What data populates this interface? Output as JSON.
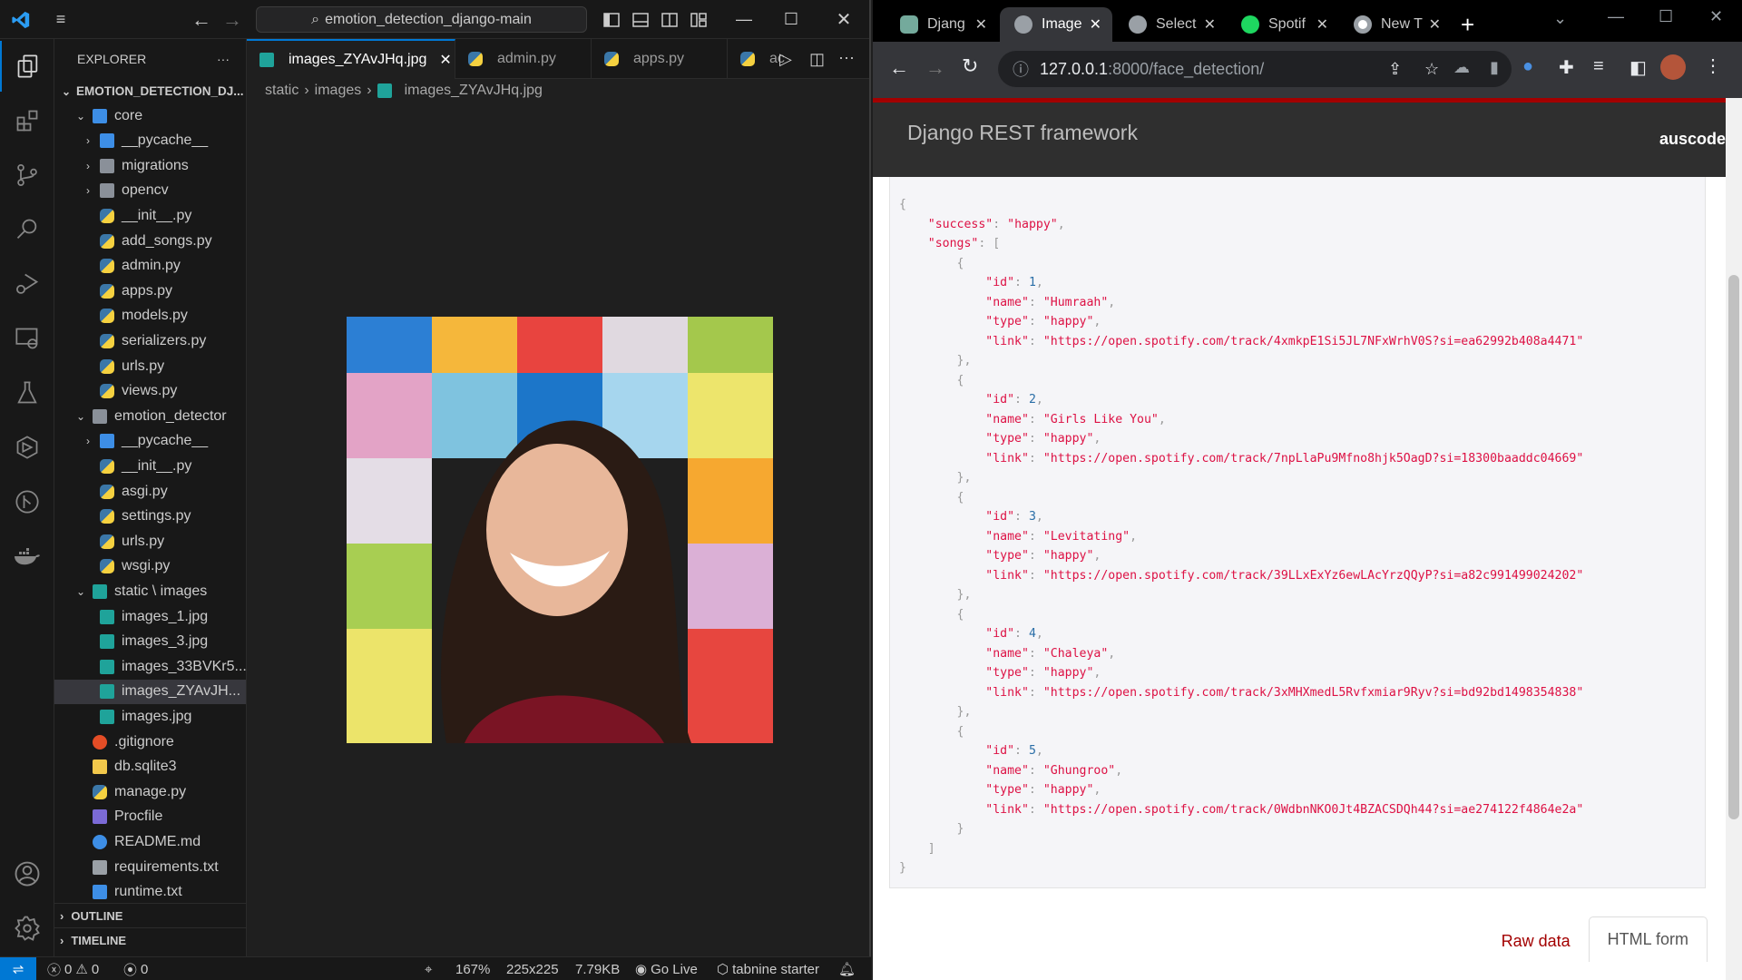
{
  "vscode": {
    "search": "emotion_detection_django-main",
    "explorer_title": "EXPLORER",
    "root_folder": "EMOTION_DETECTION_DJ...",
    "tree": [
      {
        "label": "core",
        "depth": 1,
        "type": "folder-open-blue",
        "chev": "down"
      },
      {
        "label": "__pycache__",
        "depth": 2,
        "type": "folder-py",
        "chev": "right"
      },
      {
        "label": "migrations",
        "depth": 2,
        "type": "folder",
        "chev": "right"
      },
      {
        "label": "opencv",
        "depth": 2,
        "type": "folder",
        "chev": "right"
      },
      {
        "label": "__init__.py",
        "depth": 2,
        "type": "py"
      },
      {
        "label": "add_songs.py",
        "depth": 2,
        "type": "py"
      },
      {
        "label": "admin.py",
        "depth": 2,
        "type": "py"
      },
      {
        "label": "apps.py",
        "depth": 2,
        "type": "py"
      },
      {
        "label": "models.py",
        "depth": 2,
        "type": "py"
      },
      {
        "label": "serializers.py",
        "depth": 2,
        "type": "py"
      },
      {
        "label": "urls.py",
        "depth": 2,
        "type": "py"
      },
      {
        "label": "views.py",
        "depth": 2,
        "type": "py"
      },
      {
        "label": "emotion_detector",
        "depth": 1,
        "type": "folder-open",
        "chev": "down"
      },
      {
        "label": "__pycache__",
        "depth": 2,
        "type": "folder-py",
        "chev": "right"
      },
      {
        "label": "__init__.py",
        "depth": 2,
        "type": "py"
      },
      {
        "label": "asgi.py",
        "depth": 2,
        "type": "py"
      },
      {
        "label": "settings.py",
        "depth": 2,
        "type": "py"
      },
      {
        "label": "urls.py",
        "depth": 2,
        "type": "py"
      },
      {
        "label": "wsgi.py",
        "depth": 2,
        "type": "py"
      },
      {
        "label": "static \\ images",
        "depth": 1,
        "type": "folder-img",
        "chev": "down"
      },
      {
        "label": "images_1.jpg",
        "depth": 2,
        "type": "img"
      },
      {
        "label": "images_3.jpg",
        "depth": 2,
        "type": "img"
      },
      {
        "label": "images_33BVKr5...",
        "depth": 2,
        "type": "img"
      },
      {
        "label": "images_ZYAvJH...",
        "depth": 2,
        "type": "img",
        "selected": true
      },
      {
        "label": "images.jpg",
        "depth": 2,
        "type": "img"
      },
      {
        "label": ".gitignore",
        "depth": 1,
        "type": "git"
      },
      {
        "label": "db.sqlite3",
        "depth": 1,
        "type": "db"
      },
      {
        "label": "manage.py",
        "depth": 1,
        "type": "py"
      },
      {
        "label": "Procfile",
        "depth": 1,
        "type": "heroku"
      },
      {
        "label": "README.md",
        "depth": 1,
        "type": "info"
      },
      {
        "label": "requirements.txt",
        "depth": 1,
        "type": "txt"
      },
      {
        "label": "runtime.txt",
        "depth": 1,
        "type": "txt-blue"
      }
    ],
    "outline": "OUTLINE",
    "timeline": "TIMELINE",
    "tabs": [
      {
        "label": "images_ZYAvJHq.jpg",
        "type": "img",
        "active": true
      },
      {
        "label": "admin.py",
        "type": "py"
      },
      {
        "label": "apps.py",
        "type": "py"
      },
      {
        "label": "ac",
        "type": "py"
      }
    ],
    "breadcrumb": [
      "static",
      "images",
      "images_ZYAvJHq.jpg"
    ],
    "status": {
      "errors": "0",
      "warnings": "0",
      "ports": "0",
      "zoom": "167%",
      "dimensions": "225x225",
      "size": "7.79KB",
      "go_live": "Go Live",
      "tabnine": "tabnine starter"
    }
  },
  "chrome": {
    "tabs": [
      {
        "label": "Djang",
        "icon": "chatgpt",
        "active": false
      },
      {
        "label": "Image",
        "icon": "globe",
        "active": true
      },
      {
        "label": "Select",
        "icon": "globe",
        "active": false
      },
      {
        "label": "Spotif",
        "icon": "spotify",
        "active": false
      },
      {
        "label": "New T",
        "icon": "chrome",
        "active": false
      }
    ],
    "url_host": "127.0.0.1",
    "url_rest": ":8000/face_detection/",
    "brand": "Django REST framework",
    "user": "auscode",
    "raw_data": "Raw data",
    "html_form": "HTML form"
  },
  "response": {
    "success": "happy",
    "songs": [
      {
        "id": 1,
        "name": "Humraah",
        "type": "happy",
        "link": "https://open.spotify.com/track/4xmkpE1Si5JL7NFxWrhV0S?si=ea62992b408a4471"
      },
      {
        "id": 2,
        "name": "Girls Like You",
        "type": "happy",
        "link": "https://open.spotify.com/track/7npLlaPu9Mfno8hjk5OagD?si=18300baaddc04669"
      },
      {
        "id": 3,
        "name": "Levitating",
        "type": "happy",
        "link": "https://open.spotify.com/track/39LLxExYz6ewLAcYrzQQyP?si=a82c991499024202"
      },
      {
        "id": 4,
        "name": "Chaleya",
        "type": "happy",
        "link": "https://open.spotify.com/track/3xMHXmedL5Rvfxmiar9Ryv?si=bd92bd1498354838"
      },
      {
        "id": 5,
        "name": "Ghungroo",
        "type": "happy",
        "link": "https://open.spotify.com/track/0WdbnNKO0Jt4BZACSDQh44?si=ae274122f4864e2a"
      }
    ]
  }
}
